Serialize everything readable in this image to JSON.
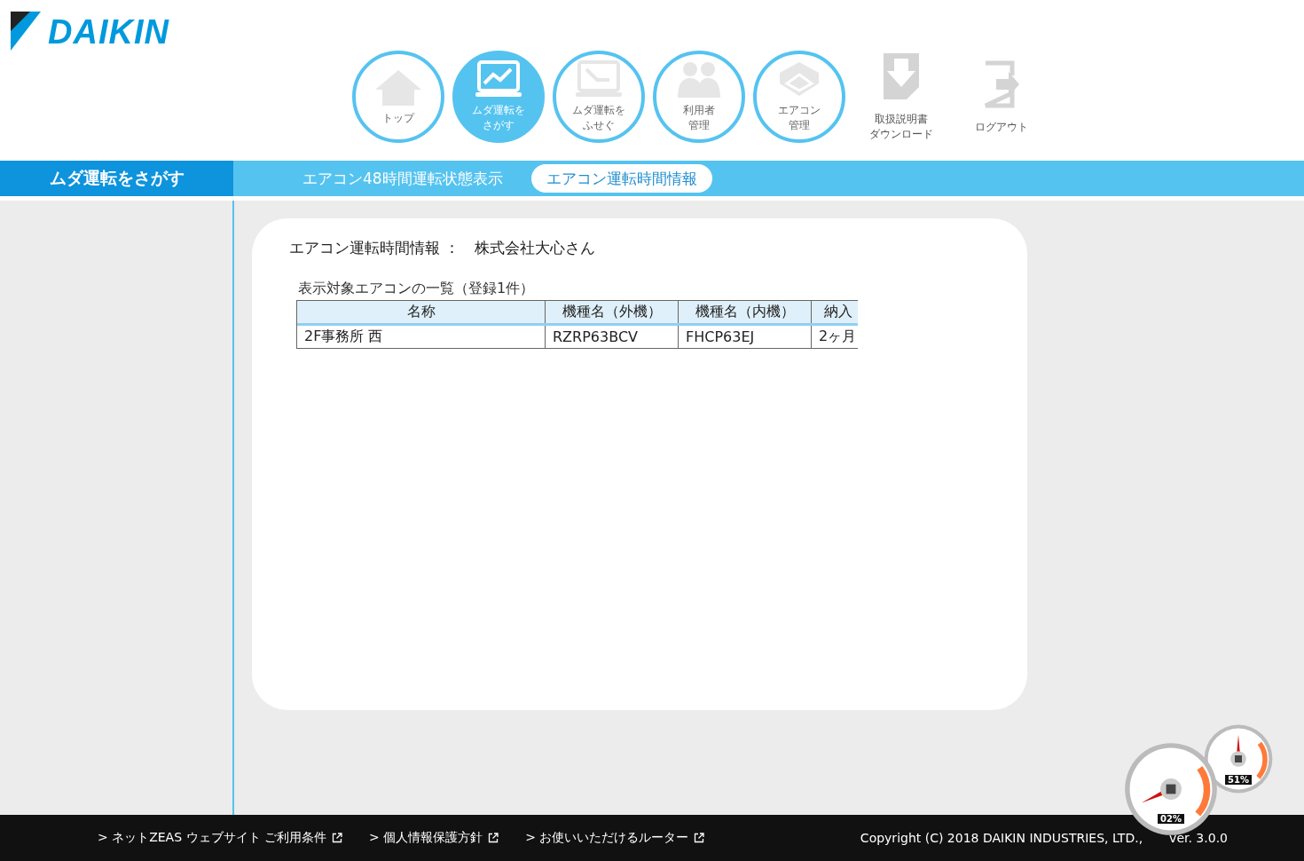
{
  "logo": {
    "text": "DAIKIN"
  },
  "nav": [
    {
      "label": [
        "トップ"
      ],
      "selected": false
    },
    {
      "label": [
        "ムダ運転を",
        "さがす"
      ],
      "selected": true
    },
    {
      "label": [
        "ムダ運転を",
        "ふせぐ"
      ],
      "selected": false
    },
    {
      "label": [
        "利用者",
        "管理"
      ],
      "selected": false
    },
    {
      "label": [
        "エアコン",
        "管理"
      ],
      "selected": false
    }
  ],
  "tools": [
    {
      "label": [
        "取扱説明書",
        "ダウンロード"
      ]
    },
    {
      "label": [
        "ログアウト"
      ]
    }
  ],
  "section_title": "ムダ運転をさがす",
  "tabs": [
    {
      "label": "エアコン48時間運転状態表示",
      "selected": false
    },
    {
      "label": "エアコン運転時間情報",
      "selected": true
    }
  ],
  "card": {
    "heading": "エアコン運転時間情報 ：　株式会社大心さん",
    "table_caption": "表示対象エアコンの一覧（登録1件）",
    "columns": [
      "名称",
      "機種名（外機）",
      "機種名（内機）",
      "納入"
    ],
    "rows": [
      [
        "2F事務所 西",
        "RZRP63BCV",
        "FHCP63EJ",
        "2ヶ月"
      ]
    ]
  },
  "footer": {
    "links": [
      "> ネットZEAS ウェブサイト ご利用条件",
      "> 個人情報保護方針",
      "> お使いいただけるルーター"
    ],
    "copyright": "Copyright (C) 2018 DAIKIN INDUSTRIES, LTD.,",
    "version": "ver. 3.0.0"
  },
  "gauges": [
    {
      "reading": "02%"
    },
    {
      "reading": "51%"
    }
  ]
}
